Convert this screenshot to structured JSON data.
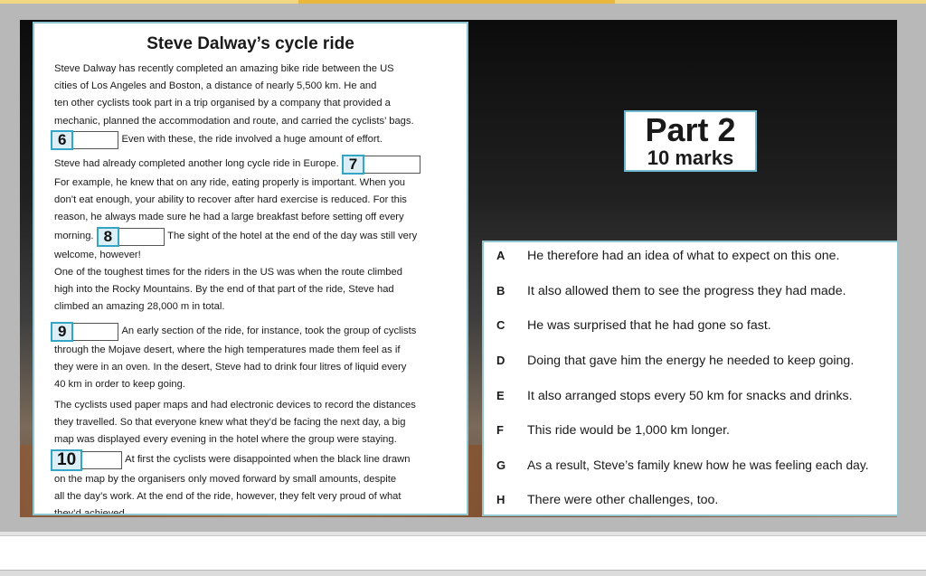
{
  "passage": {
    "title": "Steve Dalway’s cycle ride",
    "p1": {
      "line1": "Steve Dalway has recently completed an amazing bike ride between the US",
      "line2": "cities of Los Angeles and Boston, a distance of nearly 5,500 km. He and",
      "line3": "ten other cyclists took part in a trip organised by a company that provided a",
      "line4": "mechanic, planned the accommodation and route, and carried the cyclists’ bags.",
      "gap": "6",
      "line5": "Even with these, the ride involved a huge amount of effort."
    },
    "p2": {
      "line1": "Steve had already completed another long cycle ride in Europe.",
      "gap1": "7",
      "line2": "For example, he knew that on any ride, eating properly is important. When you",
      "line3": "don’t eat enough, your ability to recover after hard exercise is reduced. For this",
      "line4": "reason, he always made sure he had a large breakfast before setting off every",
      "line5a": "morning.",
      "gap2": "8",
      "line5b": "The sight of the hotel at the end of the day was still very",
      "line6": "welcome, however!"
    },
    "p3": {
      "line1": "One of the toughest times for the riders in the US was when the route climbed",
      "line2": "high into the Rocky Mountains. By the end of that part of the ride, Steve had",
      "line3": "climbed an amazing 28,000 m in total."
    },
    "p4": {
      "gap": "9",
      "line1": "An early section of the ride, for instance, took the group of cyclists",
      "line2": "through the Mojave desert, where the high temperatures made them feel as if",
      "line3": "they were in an oven. In the desert, Steve had to drink four litres of liquid every",
      "line4": "40 km in order to keep going."
    },
    "p5": {
      "line1": "The cyclists used paper maps and had electronic devices to record the distances",
      "line2": "they travelled. So that everyone knew what they’d be facing the next day, a big",
      "line3": "map was displayed every evening in the hotel where the group were staying.",
      "gap": "10",
      "line4": "At first the cyclists were disappointed when the black line drawn",
      "line5": "on the map by the organisers only moved forward by small amounts, despite",
      "line6": "all the day’s work. At the end of the ride, however, they felt very proud of what",
      "line7": "they’d achieved."
    }
  },
  "part": {
    "title": "Part 2",
    "marks": "10 marks"
  },
  "options": [
    {
      "letter": "A",
      "text": "He therefore had an idea of what to expect on this one."
    },
    {
      "letter": "B",
      "text": "It also allowed them to see the progress they had made."
    },
    {
      "letter": "C",
      "text": "He was surprised that he had gone so fast."
    },
    {
      "letter": "D",
      "text": "Doing that gave him the energy he needed to keep going."
    },
    {
      "letter": "E",
      "text": "It also arranged stops every 50 km for snacks and drinks."
    },
    {
      "letter": "F",
      "text": "This ride would be 1,000 km longer."
    },
    {
      "letter": "G",
      "text": "As a result, Steve’s family knew how he was feeling each day."
    },
    {
      "letter": "H",
      "text": "There were other challenges, too."
    }
  ]
}
